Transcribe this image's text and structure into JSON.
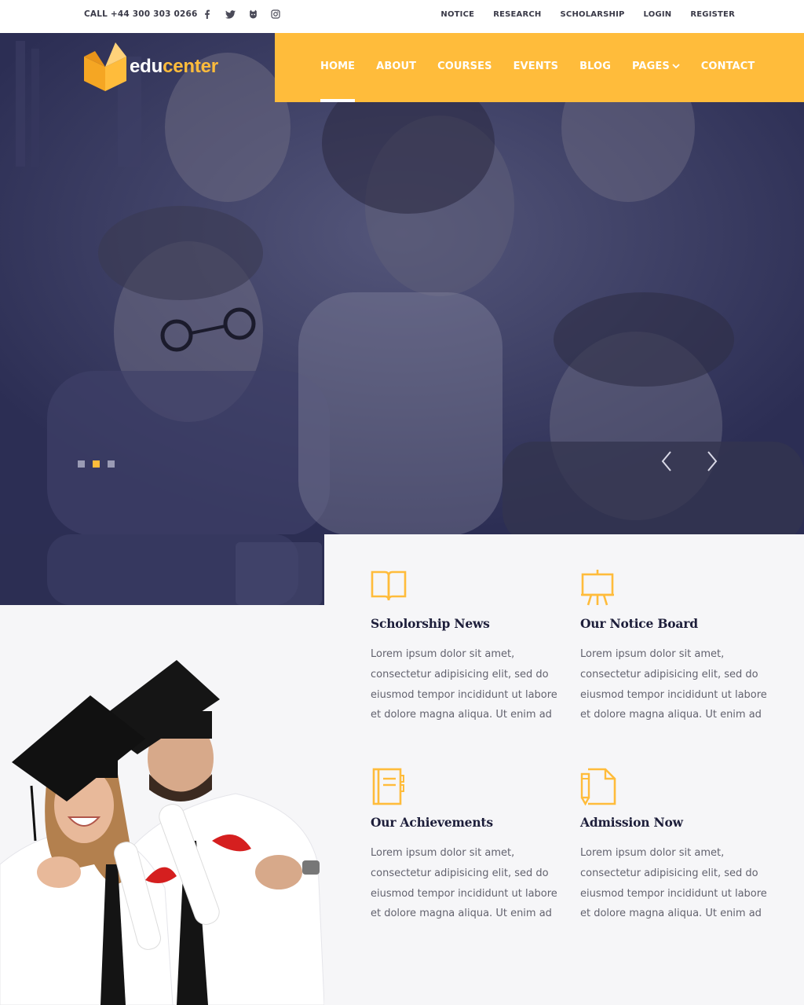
{
  "topbar": {
    "call_text": "CALL +44 300 303 0266",
    "socials": [
      "facebook-icon",
      "twitter-icon",
      "github-icon",
      "instagram-icon"
    ],
    "links": [
      "NOTICE",
      "RESEARCH",
      "SCHOLARSHIP",
      "LOGIN",
      "REGISTER"
    ]
  },
  "brand": {
    "prefix": "edu",
    "suffix": "center",
    "accent_color": "#ffbc3b"
  },
  "nav": {
    "items": [
      "HOME",
      "ABOUT",
      "COURSES",
      "EVENTS",
      "BLOG",
      "PAGES",
      "CONTACT"
    ],
    "active": "HOME",
    "background": "#ffbc3b"
  },
  "hero": {
    "slide_count": 3,
    "active_slide": 2,
    "overlay_color": "#2d2f55"
  },
  "features": [
    {
      "icon": "open-book-icon",
      "title": "Scholorship News",
      "text": "Lorem ipsum dolor sit amet, consectetur adipisicing elit, sed do eiusmod tempor incididunt ut labore et dolore magna aliqua. Ut enim ad"
    },
    {
      "icon": "easel-board-icon",
      "title": "Our Notice Board",
      "text": "Lorem ipsum dolor sit amet, consectetur adipisicing elit, sed do eiusmod tempor incididunt ut labore et dolore magna aliqua. Ut enim ad"
    },
    {
      "icon": "notebook-icon",
      "title": "Our Achievements",
      "text": "Lorem ipsum dolor sit amet, consectetur adipisicing elit, sed do eiusmod tempor incididunt ut labore et dolore magna aliqua. Ut enim ad"
    },
    {
      "icon": "document-pen-icon",
      "title": "Admission Now",
      "text": "Lorem ipsum dolor sit amet, consectetur adipisicing elit, sed do eiusmod tempor incididunt ut labore et dolore magna aliqua. Ut enim ad"
    }
  ]
}
